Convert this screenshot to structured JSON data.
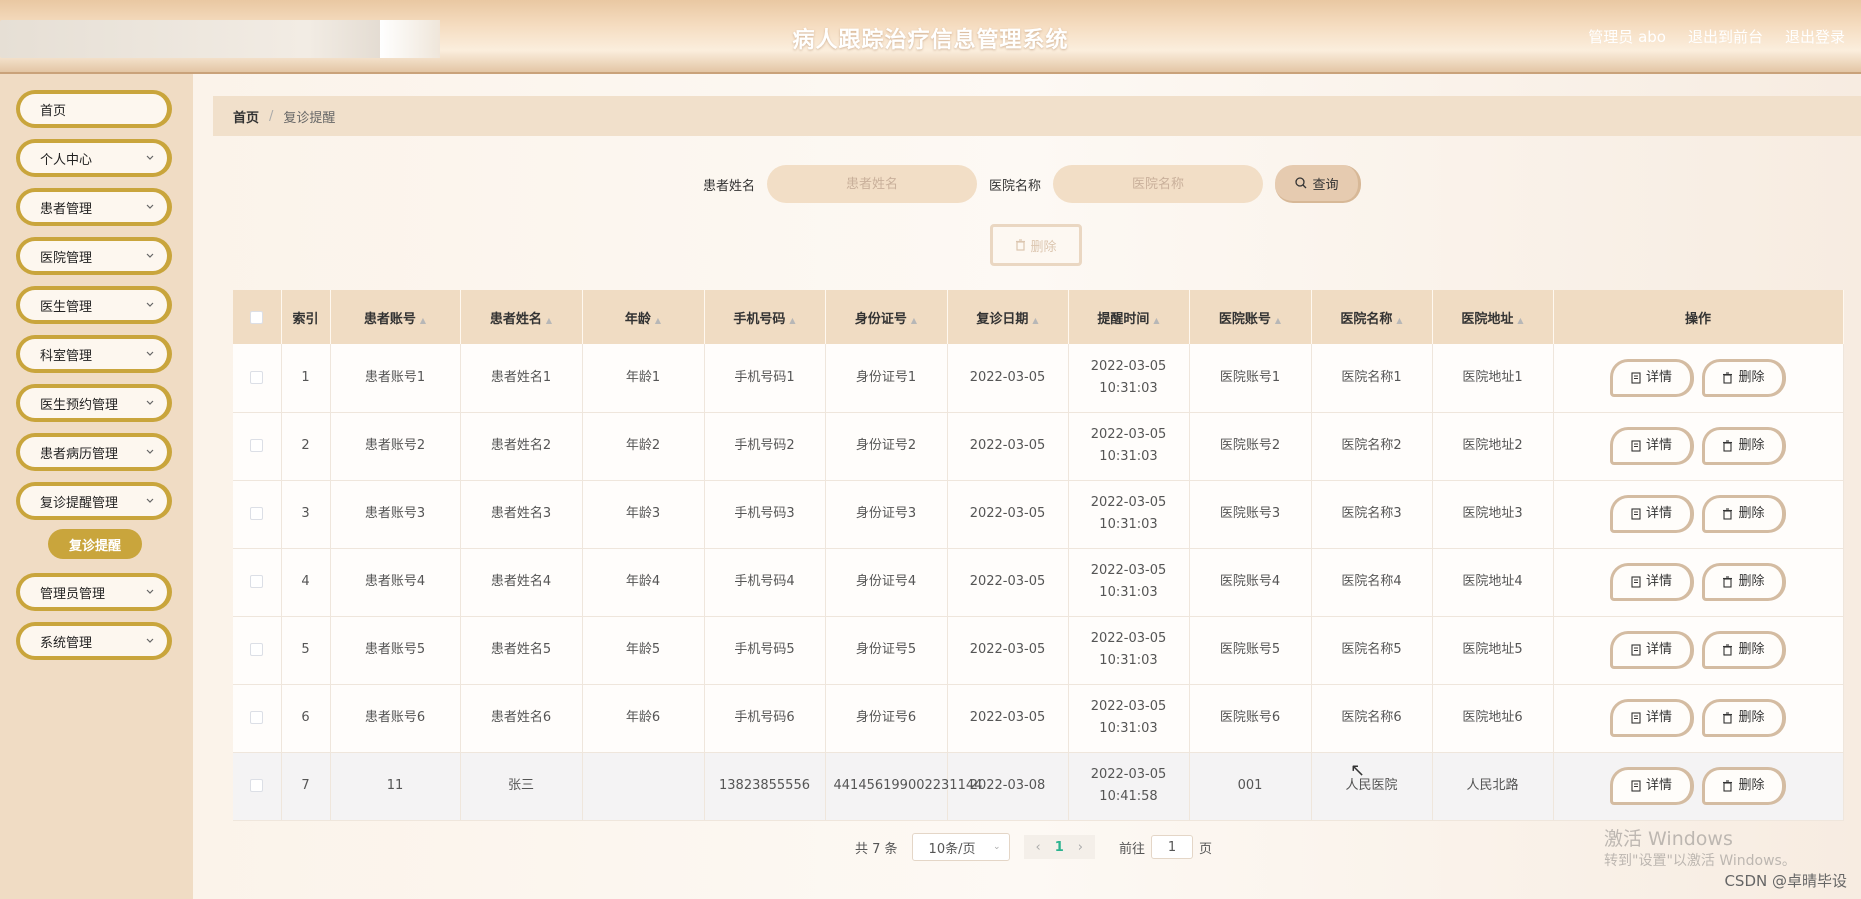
{
  "header": {
    "title": "病人跟踪治疗信息管理系统",
    "admin": "管理员 abo",
    "to_front": "退出到前台",
    "logout": "退出登录"
  },
  "sidebar": {
    "items": [
      {
        "label": "首页",
        "chevron": false
      },
      {
        "label": "个人中心",
        "chevron": true
      },
      {
        "label": "患者管理",
        "chevron": true
      },
      {
        "label": "医院管理",
        "chevron": true
      },
      {
        "label": "医生管理",
        "chevron": true
      },
      {
        "label": "科室管理",
        "chevron": true
      },
      {
        "label": "医生预约管理",
        "chevron": true
      },
      {
        "label": "患者病历管理",
        "chevron": true
      },
      {
        "label": "复诊提醒管理",
        "chevron": true
      }
    ],
    "sub_active": "复诊提醒",
    "items_after": [
      {
        "label": "管理员管理",
        "chevron": true
      },
      {
        "label": "系统管理",
        "chevron": true
      }
    ]
  },
  "breadcrumb": {
    "home": "首页",
    "sep": "/",
    "current": "复诊提醒"
  },
  "search": {
    "name_label": "患者姓名",
    "name_placeholder": "患者姓名",
    "hospital_label": "医院名称",
    "hospital_placeholder": "医院名称",
    "query_label": "查询"
  },
  "delete_label": "删除",
  "table": {
    "headers": [
      "索引",
      "患者账号",
      "患者姓名",
      "年龄",
      "手机号码",
      "身份证号",
      "复诊日期",
      "提醒时间",
      "医院账号",
      "医院名称",
      "医院地址",
      "操作"
    ],
    "rows": [
      [
        "1",
        "患者账号1",
        "患者姓名1",
        "年龄1",
        "手机号码1",
        "身份证号1",
        "2022-03-05",
        "2022-03-05 10:31:03",
        "医院账号1",
        "医院名称1",
        "医院地址1"
      ],
      [
        "2",
        "患者账号2",
        "患者姓名2",
        "年龄2",
        "手机号码2",
        "身份证号2",
        "2022-03-05",
        "2022-03-05 10:31:03",
        "医院账号2",
        "医院名称2",
        "医院地址2"
      ],
      [
        "3",
        "患者账号3",
        "患者姓名3",
        "年龄3",
        "手机号码3",
        "身份证号3",
        "2022-03-05",
        "2022-03-05 10:31:03",
        "医院账号3",
        "医院名称3",
        "医院地址3"
      ],
      [
        "4",
        "患者账号4",
        "患者姓名4",
        "年龄4",
        "手机号码4",
        "身份证号4",
        "2022-03-05",
        "2022-03-05 10:31:03",
        "医院账号4",
        "医院名称4",
        "医院地址4"
      ],
      [
        "5",
        "患者账号5",
        "患者姓名5",
        "年龄5",
        "手机号码5",
        "身份证号5",
        "2022-03-05",
        "2022-03-05 10:31:03",
        "医院账号5",
        "医院名称5",
        "医院地址5"
      ],
      [
        "6",
        "患者账号6",
        "患者姓名6",
        "年龄6",
        "手机号码6",
        "身份证号6",
        "2022-03-05",
        "2022-03-05 10:31:03",
        "医院账号6",
        "医院名称6",
        "医院地址6"
      ],
      [
        "7",
        "11",
        "张三",
        "",
        "13823855556",
        "441456199002231144",
        "2022-03-08",
        "2022-03-05 10:41:58",
        "001",
        "人民医院",
        "人民北路"
      ]
    ],
    "detail_label": "详情",
    "delete_label": "删除"
  },
  "pagination": {
    "total": "共 7 条",
    "page_size": "10条/页",
    "current_page": "1",
    "goto_prefix": "前往",
    "goto_value": "1",
    "goto_suffix": "页"
  },
  "watermark": {
    "line1": "激活 Windows",
    "line2": "转到\"设置\"以激活 Windows。"
  },
  "credit": "CSDN @卓晴毕设",
  "colors": {
    "accent": "#c9a53c",
    "header_bg": "#f0dcc3",
    "page_num": "#2bb38f"
  }
}
